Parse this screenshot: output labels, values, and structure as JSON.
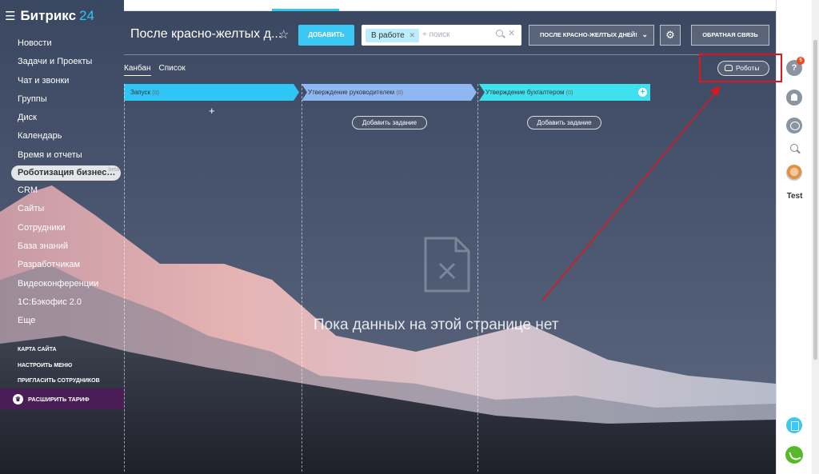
{
  "app": {
    "logo_name": "Битрикс",
    "logo_num": "24"
  },
  "sidebar": {
    "items": [
      {
        "label": "Новости"
      },
      {
        "label": "Задачи и Проекты"
      },
      {
        "label": "Чат и звонки"
      },
      {
        "label": "Группы"
      },
      {
        "label": "Диск"
      },
      {
        "label": "Календарь"
      },
      {
        "label": "Время и отчеты"
      },
      {
        "label": "Роботизация бизнес…",
        "badge": "beta",
        "active": true
      },
      {
        "label": "CRM"
      },
      {
        "label": "Сайты"
      },
      {
        "label": "Сотрудники"
      },
      {
        "label": "База знаний"
      },
      {
        "label": "Разработчикам"
      },
      {
        "label": "Видеоконференции"
      },
      {
        "label": "1С:Бэкофис 2.0"
      },
      {
        "label": "Еще"
      }
    ],
    "links": [
      "КАРТА САЙТА",
      "НАСТРОИТЬ МЕНЮ",
      "ПРИГЛАСИТЬ СОТРУДНИКОВ"
    ],
    "upgrade_label": "РАСШИРИТЬ ТАРИФ"
  },
  "header": {
    "title": "После красно-желтых д...",
    "add_button": "ДОБАВИТЬ",
    "filter_tag": "В работе",
    "search_placeholder": "+ поиск",
    "stage_button": "ПОСЛЕ КРАСНО-ЖЕЛТЫХ ДНЕЙ!",
    "feedback_button": "ОБРАТНАЯ СВЯЗЬ"
  },
  "views": {
    "tabs": [
      "Канбан",
      "Список"
    ],
    "active": "Канбан",
    "robots_button": "Роботы"
  },
  "kanban": {
    "columns": [
      {
        "title": "Запуск",
        "count": "(0)",
        "color": "#2fc6f6"
      },
      {
        "title": "Утверждение руководителем",
        "count": "(0)",
        "color": "#8fb8f2"
      },
      {
        "title": "Утверждение бухгалтером",
        "count": "(0)",
        "color": "#3ee1ee"
      }
    ],
    "add_task_label": "Добавить задание",
    "empty_text": "Пока данных на этой странице нет"
  },
  "rightbar": {
    "help_badge": "5",
    "user_name": "Test"
  },
  "colors": {
    "accent": "#2fc6f6",
    "add_button": "#3bc8f5",
    "highlight": "#e2151b",
    "upgrade": "#4a1d57"
  }
}
